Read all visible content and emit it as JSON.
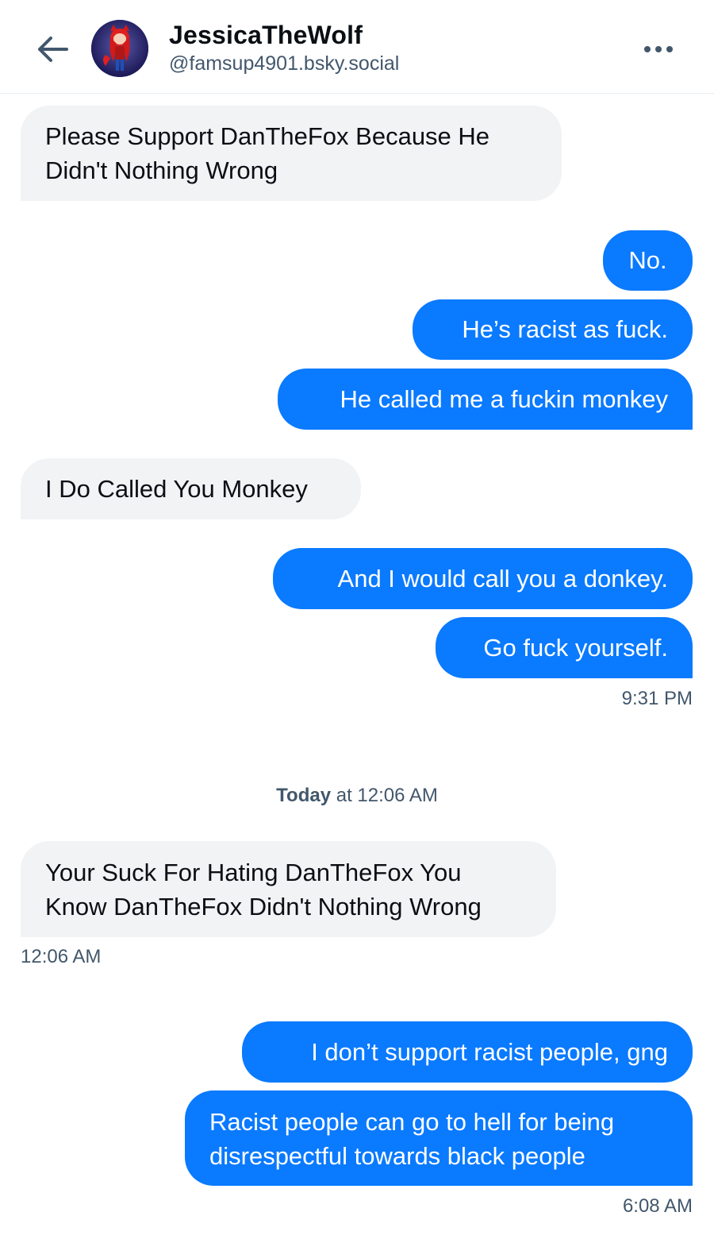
{
  "header": {
    "display_name": "JessicaTheWolf",
    "handle": "@famsup4901.bsky.social",
    "back_icon": "arrow-left-icon",
    "more_icon": "ellipsis-icon"
  },
  "colors": {
    "accent": "#0a7aff",
    "them_bubble": "#f1f3f5",
    "muted_text": "#42576c"
  },
  "messages": [
    {
      "from": "them",
      "text": "Please Support DanTheFox Because He\nDidn't Nothing Wrong"
    },
    {
      "from": "me",
      "text": "No."
    },
    {
      "from": "me",
      "text": "He’s racist as fuck."
    },
    {
      "from": "me",
      "text": "He called me a fuckin monkey"
    },
    {
      "from": "them",
      "text": "I Do Called You Monkey"
    },
    {
      "from": "me",
      "text": "And I would call you a donkey."
    },
    {
      "from": "me",
      "text": "Go fuck yourself."
    },
    {
      "from": "them",
      "text": "Your Suck For Hating DanTheFox You\nKnow DanTheFox Didn't Nothing Wrong"
    },
    {
      "from": "me",
      "text": "I don’t support racist people, gng"
    },
    {
      "from": "me",
      "text": "Racist people can go to hell for being\ndisrespectful towards black people"
    }
  ],
  "timestamps": {
    "t1": "9:31 PM",
    "t2": "12:06 AM",
    "t3": "6:08 AM"
  },
  "date_separator": {
    "day": "Today",
    "rest": " at 12:06 AM"
  }
}
